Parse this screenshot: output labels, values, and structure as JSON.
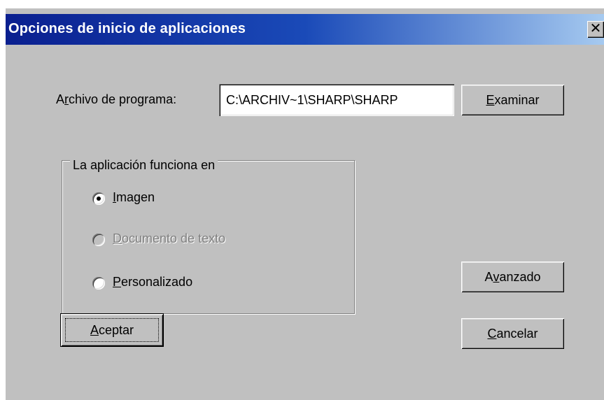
{
  "window": {
    "title": "Opciones de inicio de aplicaciones",
    "close_glyph": "✕"
  },
  "program_file": {
    "label_prefix": "A",
    "label_mnemonic": "r",
    "label_suffix": "chivo de programa:",
    "value": "C:\\ARCHIV~1\\SHARP\\SHARP"
  },
  "buttons": {
    "browse": {
      "mnemonic": "E",
      "rest": "xaminar"
    },
    "advanced": {
      "prefix": "A",
      "mnemonic": "v",
      "rest": "anzado"
    },
    "accept": {
      "mnemonic": "A",
      "rest": "ceptar"
    },
    "cancel": {
      "mnemonic": "C",
      "rest": "ancelar"
    }
  },
  "group": {
    "title": "La aplicación funciona en",
    "options": [
      {
        "mnemonic": "I",
        "rest": "magen",
        "checked": true,
        "enabled": true
      },
      {
        "mnemonic": "D",
        "rest": "ocumento de texto",
        "checked": false,
        "enabled": false
      },
      {
        "mnemonic": "P",
        "rest": "ersonalizado",
        "checked": false,
        "enabled": true
      }
    ]
  },
  "colors": {
    "title_gradient_start": "#0a1f8f",
    "title_gradient_end": "#a6caf0",
    "face": "#c0c0c0"
  }
}
